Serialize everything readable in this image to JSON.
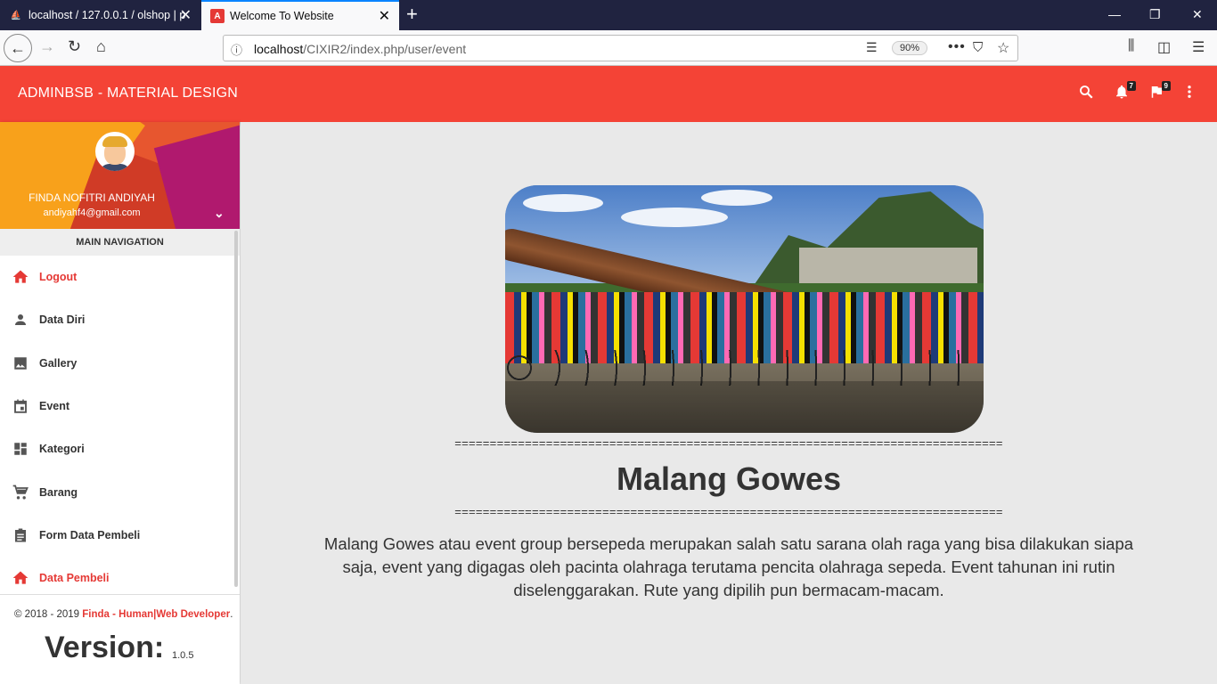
{
  "browser": {
    "tabs": [
      {
        "title": "localhost / 127.0.0.1 / olshop | p",
        "favicon": "phpmyadmin-icon",
        "active": false
      },
      {
        "title": "Welcome To Website",
        "favicon": "angular-icon",
        "active": true
      }
    ],
    "url_host": "localhost",
    "url_path": "/CIXIR2/index.php/user/event",
    "zoom": "90%"
  },
  "header": {
    "brand": "ADMINBSB - MATERIAL DESIGN",
    "notifications_count": "7",
    "tasks_count": "9"
  },
  "user": {
    "name": "FINDA NOFITRI ANDIYAH",
    "email": "andiyahf4@gmail.com"
  },
  "sidebar": {
    "header": "MAIN NAVIGATION",
    "items": [
      {
        "label": "Logout",
        "icon": "home-icon",
        "active": true
      },
      {
        "label": "Data Diri",
        "icon": "person-icon",
        "active": false
      },
      {
        "label": "Gallery",
        "icon": "image-icon",
        "active": false
      },
      {
        "label": "Event",
        "icon": "calendar-icon",
        "active": false
      },
      {
        "label": "Kategori",
        "icon": "dashboard-icon",
        "active": false
      },
      {
        "label": "Barang",
        "icon": "cart-icon",
        "active": false
      },
      {
        "label": "Form Data Pembeli",
        "icon": "assignment-icon",
        "active": false
      },
      {
        "label": "Data Pembeli",
        "icon": "home-icon",
        "active": true
      }
    ]
  },
  "footer": {
    "copyright_prefix": "© 2018 - 2019 ",
    "copyright_link": "Finda - Human|Web Developer",
    "copyright_suffix": ".",
    "version_label": "Version:",
    "version_number": "1.0.5"
  },
  "event": {
    "divider": "==============================================================================",
    "title": "Malang Gowes",
    "description": "Malang Gowes atau event group bersepeda merupakan salah satu sarana olah raga yang bisa dilakukan siapa saja, event yang digagas oleh pacinta olahraga terutama pencita olahraga sepeda. Event tahunan ini rutin diselenggarakan. Rute yang dipilih pun bermacam-macam."
  },
  "colors": {
    "accent": "#f44336",
    "active_menu": "#e53935"
  }
}
